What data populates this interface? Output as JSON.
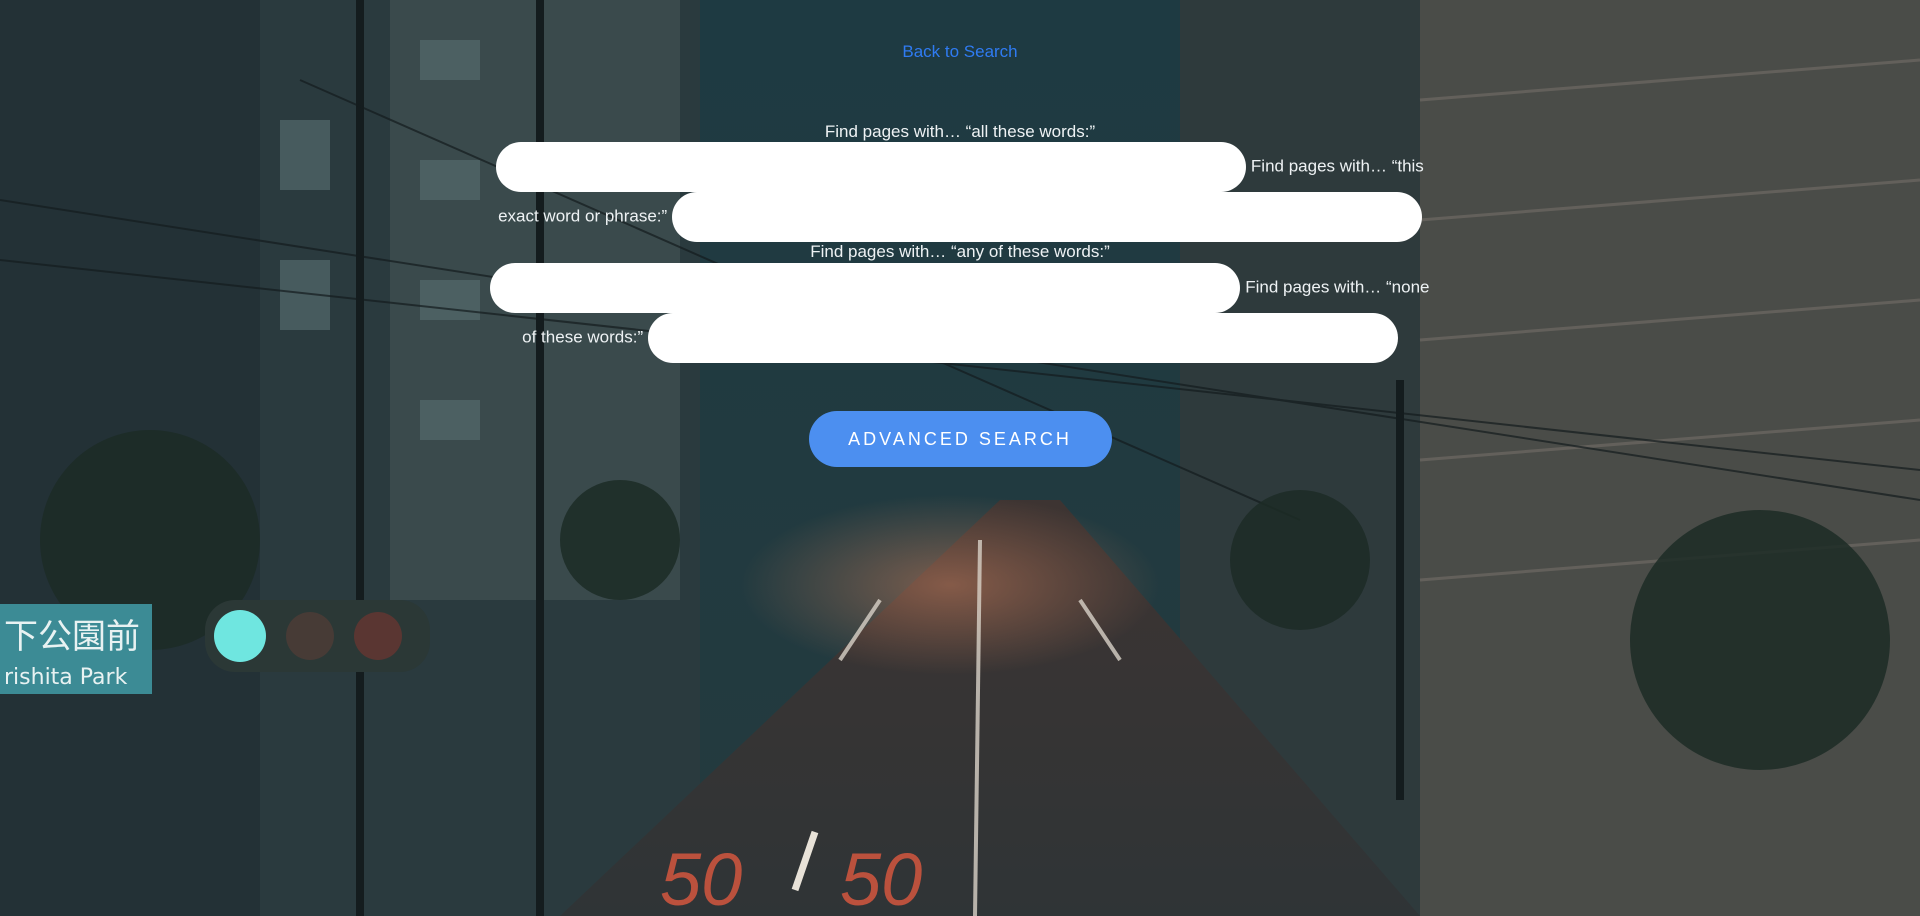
{
  "back_link": "Back to Search",
  "fields": [
    {
      "label": "Find pages with… “all these words:”",
      "value": "",
      "placeholder": ""
    },
    {
      "label": "Find pages with… “this exact word or phrase:”",
      "value": "",
      "placeholder": ""
    },
    {
      "label": "Find pages with… “any of these words:”",
      "value": "",
      "placeholder": ""
    },
    {
      "label": "Find pages with… “none of these words:”",
      "value": "",
      "placeholder": ""
    }
  ],
  "submit_label": "ADVANCED SEARCH",
  "colors": {
    "link": "#2f7bf2",
    "button": "#4c8ff0",
    "input_bg": "#ffffff",
    "label_text": "#eef2f4"
  },
  "background": {
    "sign_text": "下公園前",
    "sign_subtext": "rishita Park",
    "road_marking_left": "50",
    "road_marking_right": "50"
  }
}
